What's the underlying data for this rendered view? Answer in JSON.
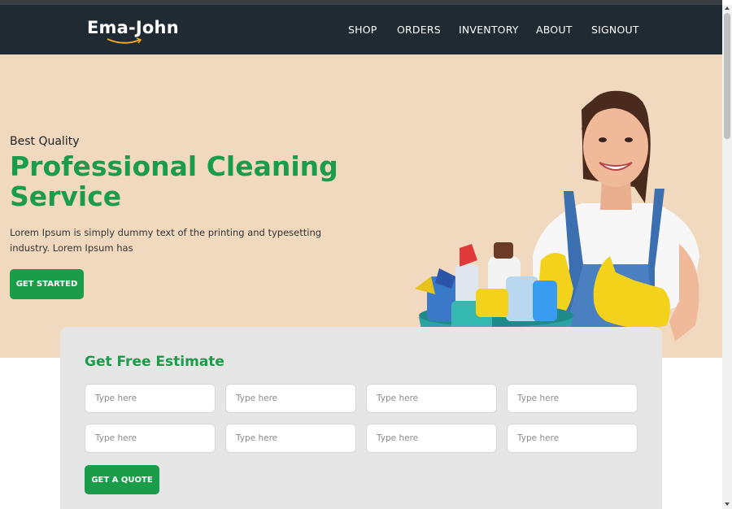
{
  "brand": {
    "logo_text": "Ema-John",
    "accent_color": "#f5a623"
  },
  "nav": {
    "items": [
      {
        "label": "SHOP"
      },
      {
        "label": "ORDERS"
      },
      {
        "label": "INVENTORY"
      },
      {
        "label": "ABOUT"
      },
      {
        "label": "SIGNOUT"
      }
    ]
  },
  "hero": {
    "kicker": "Best Quality",
    "title": "Professional Cleaning Service",
    "description": "Lorem Ipsum is simply dummy text of the printing and typesetting industry. Lorem Ipsum has",
    "cta_label": "GET STARTED",
    "background_color": "#f1d9bf",
    "accent_color": "#1a9c4a"
  },
  "estimate": {
    "title": "Get Free Estimate",
    "fields": [
      {
        "placeholder": "Type here"
      },
      {
        "placeholder": "Type here"
      },
      {
        "placeholder": "Type here"
      },
      {
        "placeholder": "Type here"
      },
      {
        "placeholder": "Type here"
      },
      {
        "placeholder": "Type here"
      },
      {
        "placeholder": "Type here"
      },
      {
        "placeholder": "Type here"
      }
    ],
    "submit_label": "GET A QUOTE"
  }
}
